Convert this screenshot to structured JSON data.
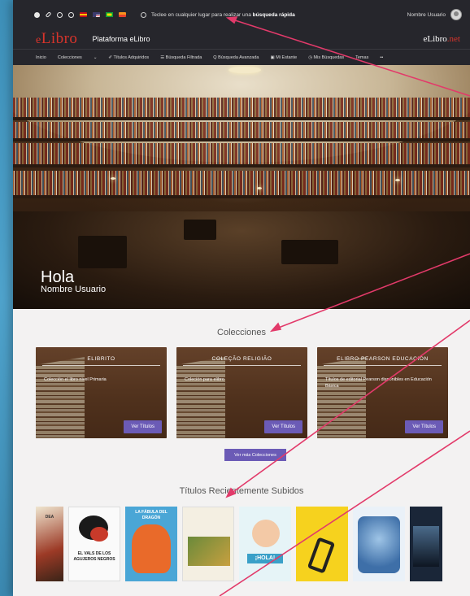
{
  "topbar": {
    "search_text_prefix": "Teclee en cualquier lugar para realizar una",
    "search_text_bold": "búsqueda rápida",
    "user_name": "Nombre Usuario"
  },
  "brand": {
    "logo_e": "e",
    "logo_rest": "Libro",
    "platform": "Plataforma eLibro",
    "right_prefix": "eLibro",
    "right_suffix": ".net"
  },
  "nav": {
    "items": [
      {
        "label": "Inicio"
      },
      {
        "label": "Colecciones"
      },
      {
        "label": "⌄"
      },
      {
        "label": "✐ Títulos Adquiridos"
      },
      {
        "label": "☰ Búsqueda Filtrada"
      },
      {
        "label": "Q Búsqueda Avanzada"
      },
      {
        "label": "▣ Mi Estante"
      },
      {
        "label": "◷ Mis Búsquedas"
      },
      {
        "label": "Temas"
      },
      {
        "label": "••"
      }
    ]
  },
  "hero": {
    "greeting": "Hola",
    "user_name": "Nombre Usuario"
  },
  "collections": {
    "title": "Colecciones",
    "cards": [
      {
        "title": "ELIBRITO",
        "desc": "Colección el libro nivel Primaria",
        "button": "Ver Títulos"
      },
      {
        "title": "COLEÇÃO RELIGIÃO",
        "desc": "Coleción para elibro",
        "button": "Ver Títulos"
      },
      {
        "title": "ELIBRO PEARSON EDUCACIÓN",
        "desc": "Títulos de editorial Pearson disponibles en Educación Básica",
        "button": "Ver Títulos"
      }
    ],
    "more_button": "Ver más Colecciones"
  },
  "recent": {
    "title": "Títulos Recientemente Subidos",
    "books": [
      {
        "text": "DEA"
      },
      {
        "text": "EL VALS DE LOS AGUJEROS NEGROS"
      },
      {
        "text": "LA FÁBULA DEL DRAGÓN"
      },
      {
        "text": ""
      },
      {
        "text": "¡HOLA!"
      },
      {
        "text": ""
      },
      {
        "text": ""
      },
      {
        "text": ""
      }
    ]
  },
  "colors": {
    "accent": "#6b5bb6",
    "logo_red": "#d9342b",
    "header_bg": "#26262c",
    "annotation": "#e23a6a"
  }
}
